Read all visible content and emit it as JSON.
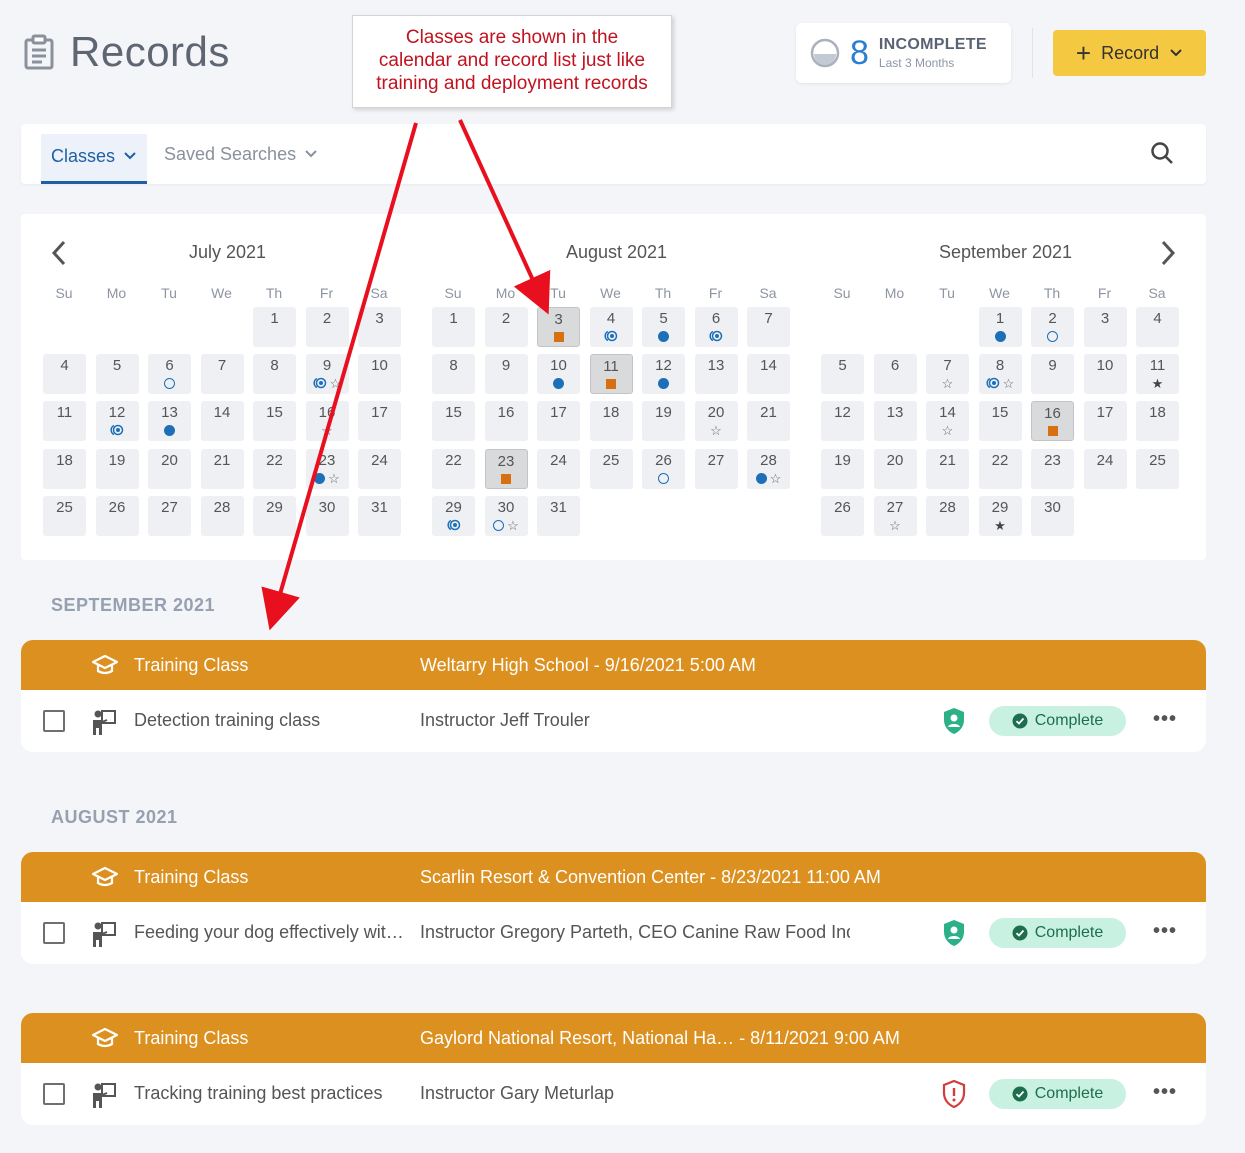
{
  "header": {
    "title": "Records",
    "incomplete": {
      "count": "8",
      "label": "INCOMPLETE",
      "sublabel": "Last 3 Months"
    },
    "record_button": "Record"
  },
  "callout": {
    "lines": [
      "Classes are shown in the",
      "calendar and record list  just like",
      "training and deployment records"
    ]
  },
  "toolbar": {
    "tab_classes": "Classes",
    "tab_saved": "Saved Searches"
  },
  "calendar": {
    "weekdays": [
      "Su",
      "Mo",
      "Tu",
      "We",
      "Th",
      "Fr",
      "Sa"
    ],
    "months": [
      {
        "title": "July 2021",
        "first_weekday": 4,
        "days": 31,
        "marks": {
          "6": [
            "ring"
          ],
          "9": [
            "half",
            "star"
          ],
          "12": [
            "half"
          ],
          "13": [
            "dot"
          ],
          "16": [
            "star"
          ],
          "23": [
            "dot",
            "star"
          ]
        },
        "selected": []
      },
      {
        "title": "August 2021",
        "first_weekday": 0,
        "days": 31,
        "marks": {
          "3": [
            "sq"
          ],
          "4": [
            "half"
          ],
          "5": [
            "dot"
          ],
          "6": [
            "half"
          ],
          "10": [
            "dot"
          ],
          "11": [
            "sq"
          ],
          "12": [
            "dot"
          ],
          "20": [
            "star"
          ],
          "23": [
            "sq"
          ],
          "26": [
            "ring"
          ],
          "28": [
            "dot",
            "star"
          ],
          "29": [
            "half"
          ],
          "30": [
            "ring",
            "star"
          ]
        },
        "selected": [
          3,
          11,
          23
        ]
      },
      {
        "title": "September 2021",
        "first_weekday": 3,
        "days": 30,
        "marks": {
          "1": [
            "dot"
          ],
          "2": [
            "ring"
          ],
          "7": [
            "star"
          ],
          "8": [
            "half",
            "star"
          ],
          "11": [
            "starf"
          ],
          "14": [
            "star"
          ],
          "16": [
            "sq"
          ],
          "27": [
            "star"
          ],
          "29": [
            "starf"
          ]
        },
        "selected": [
          16
        ]
      }
    ]
  },
  "sections": [
    {
      "heading": "SEPTEMBER 2021",
      "records": [
        {
          "type": "Training Class",
          "location": "Weltarry High School - 9/16/2021 5:00 AM",
          "name": "Detection training class",
          "instructor": "Instructor Jeff Trouler",
          "shield": "green",
          "status": "Complete"
        }
      ]
    },
    {
      "heading": "AUGUST 2021",
      "records": [
        {
          "type": "Training Class",
          "location": "Scarlin Resort & Convention Center - 8/23/2021 11:00 AM",
          "name": "Feeding your dog effectively wit…",
          "instructor": "Instructor Gregory Parteth, CEO Canine Raw Food Indu",
          "shield": "green",
          "status": "Complete"
        },
        {
          "type": "Training Class",
          "location": "Gaylord National Resort, National Ha… - 8/11/2021 9:00 AM",
          "name": "Tracking training best practices",
          "instructor": "Instructor Gary Meturlap",
          "shield": "red",
          "status": "Complete"
        }
      ]
    }
  ],
  "colors": {
    "accent_blue": "#1f5fa3",
    "card_header": "#dc9020",
    "record_button": "#f5c842",
    "status_bg": "#c9f1e1",
    "callout_text": "#c1121f"
  }
}
